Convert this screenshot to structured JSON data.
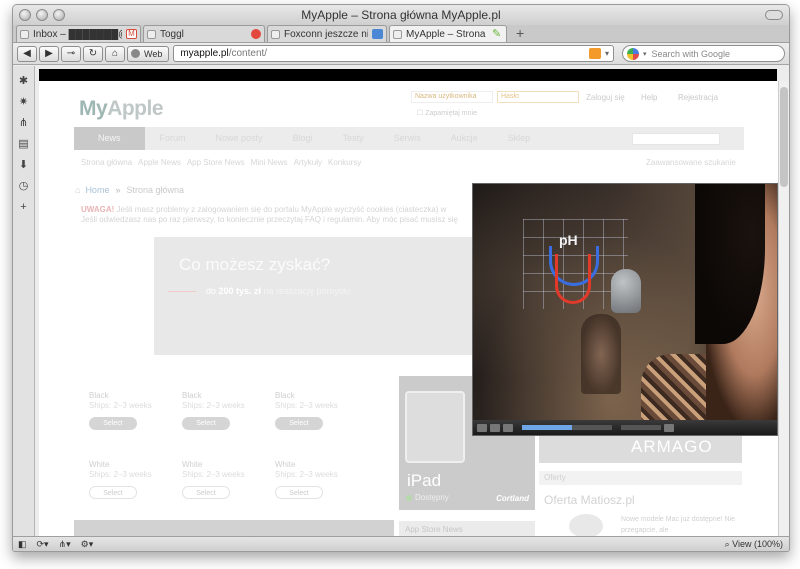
{
  "window": {
    "title": "MyApple – Strona główna MyApple.pl"
  },
  "tabs": [
    {
      "label": "Inbox – ███████@gmail.…",
      "fav_color": "#d64b3a"
    },
    {
      "label": "Toggl",
      "fav_color": "#e3483e"
    },
    {
      "label": "Foxconn jeszcze nie p…",
      "fav_color": "#4a87d4"
    },
    {
      "label": "MyApple – Strona głó…",
      "fav_color": "#6bb63a",
      "active": true
    }
  ],
  "navbar": {
    "web_label": "Web",
    "url_host": "myapple.pl",
    "url_path": "/content/",
    "search_placeholder": "Search with Google"
  },
  "page": {
    "logo_a": "My",
    "logo_b": "Apple",
    "login_user_placeholder": "Nazwa użytkownika",
    "login_pass_placeholder": "Hasło",
    "login_button": "Zaloguj się",
    "remember": "Zapamiętaj mnie",
    "help": "Help",
    "register": "Rejestracja",
    "menu": [
      "News",
      "Forum",
      "Nowe posty",
      "Blogi",
      "Testy",
      "Serwis",
      "Aukcje",
      "Sklep"
    ],
    "submenu": [
      "Strona główna",
      "Apple News",
      "App Store News",
      "Mini News",
      "Artykuły",
      "Konkursy"
    ],
    "advanced_search": "Zaawansowane szukanie",
    "breadcrumb_home": "Home",
    "breadcrumb_current": "Strona główna",
    "notice_strong": "UWAGA!",
    "notice_text": " Jeśli masz problemy z zalogowaniem się do portalu MyApple wyczyść cookies (ciasteczka) w",
    "notice_line2": "Jeśli odwiedzasz nas po raz pierwszy, to koniecznie przeczytaj FAQ i regulamin. Aby móc pisać musisz się",
    "hero_title": "Co możesz zyskać?",
    "hero_sub_prefix": "do ",
    "hero_sub_amount": "200 tys. zł",
    "hero_sub_suffix": " na realizację pomysłu",
    "products": [
      {
        "color": "Black",
        "ships": "Ships: 2–3 weeks",
        "button": "Select"
      },
      {
        "color": "Black",
        "ships": "Ships: 2–3 weeks",
        "button": "Select"
      },
      {
        "color": "Black",
        "ships": "Ships: 2–3 weeks",
        "button": "Select"
      },
      {
        "color": "White",
        "ships": "Ships: 2–3 weeks",
        "button": "Select"
      },
      {
        "color": "White",
        "ships": "Ships: 2–3 weeks",
        "button": "Select"
      },
      {
        "color": "White",
        "ships": "Ships: 2–3 weeks",
        "button": "Select"
      }
    ],
    "ipad_title": "iPad",
    "ipad_status": "Dostępny",
    "ipad_brand": "Cortland",
    "armago": "ARMAGO",
    "offers_header": "Oferty",
    "offer_title": "Oferta Matiosz.pl",
    "offer_text": "Nowe modele Mac już dostępne! Nie przegapcie, ale",
    "app_store_news": "App Store News"
  },
  "video": {
    "overlay_text": "pH",
    "progress": 0.55
  },
  "status": {
    "zoom": "View (100%)"
  }
}
